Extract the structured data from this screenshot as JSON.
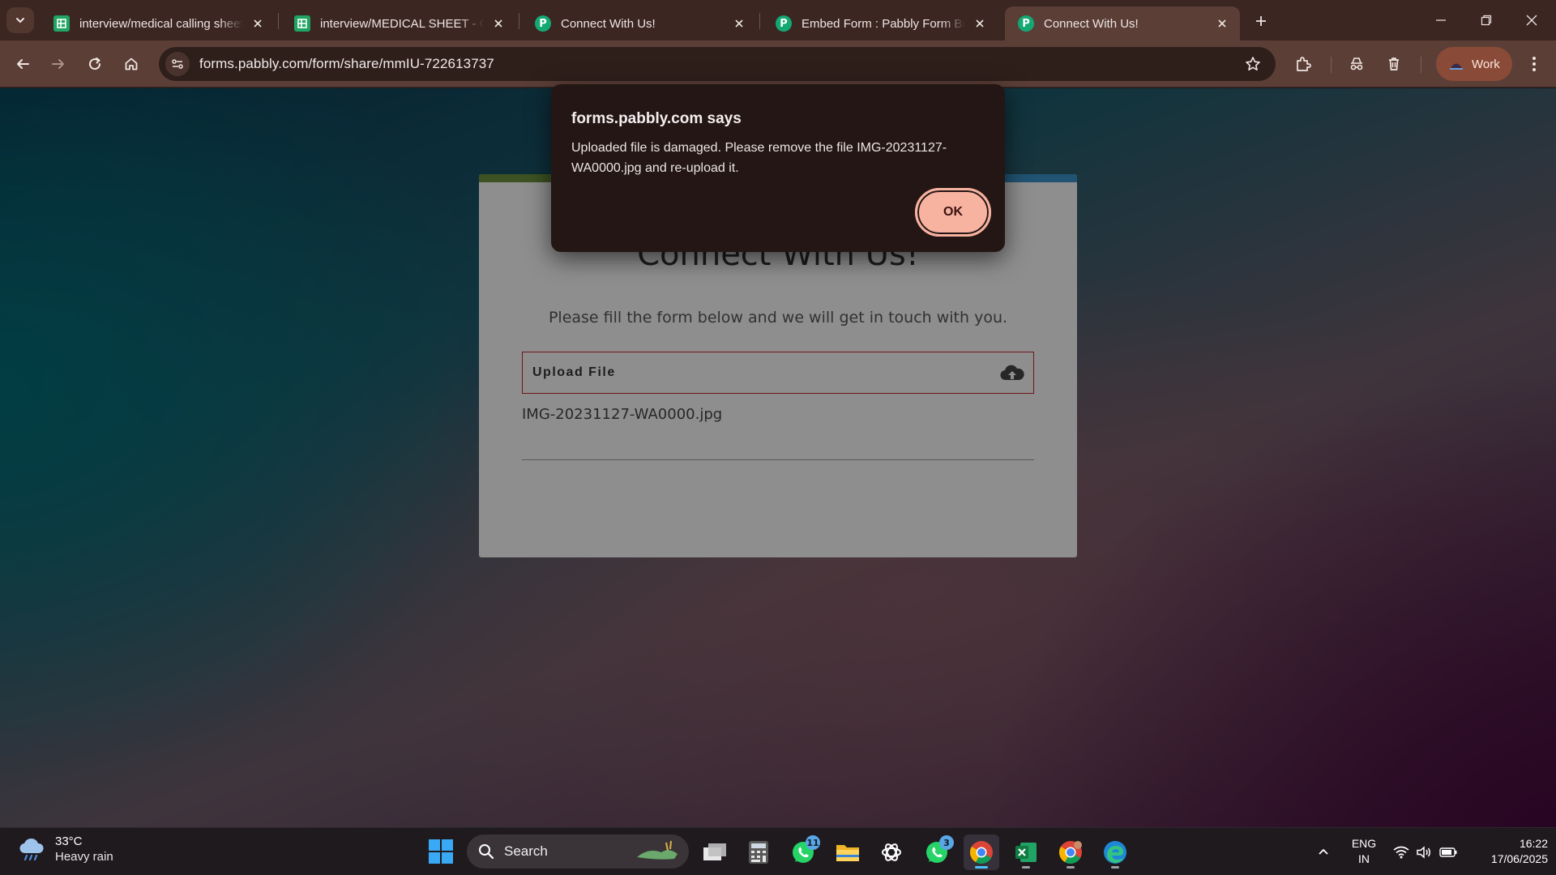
{
  "browser": {
    "tabs": [
      {
        "title": "interview/medical calling sheet",
        "favicon": "google-sheets-icon",
        "active": false
      },
      {
        "title": "interview/MEDICAL SHEET - Goo",
        "favicon": "google-sheets-icon",
        "active": false
      },
      {
        "title": "Connect With Us!",
        "favicon": "pabbly-icon",
        "active": false
      },
      {
        "title": "Embed Form : Pabbly Form Buil",
        "favicon": "pabbly-icon",
        "active": false
      },
      {
        "title": "Connect With Us!",
        "favicon": "pabbly-icon",
        "active": true
      }
    ],
    "url": "forms.pabbly.com/form/share/mmIU-722613737",
    "profile_label": "Work",
    "accent_color": "#5b3f37"
  },
  "form": {
    "title": "Connect With Us!",
    "description": "Please fill the form below and we will get in touch with you.",
    "upload_label": "Upload File",
    "file_name": "IMG-20231127-WA0000.jpg"
  },
  "dialog": {
    "title": "forms.pabbly.com says",
    "message": "Uploaded file is damaged. Please remove the file IMG-20231127-WA0000.jpg and re-upload it.",
    "ok_label": "OK",
    "button_color": "#f7b2a0"
  },
  "taskbar": {
    "weather_temp": "33°C",
    "weather_condition": "Heavy rain",
    "search_label": "Search",
    "whatsapp_badge": "11",
    "whatsapp_business_badge": "3",
    "language_line1": "ENG",
    "language_line2": "IN",
    "time": "16:22",
    "date": "17/06/2025"
  }
}
